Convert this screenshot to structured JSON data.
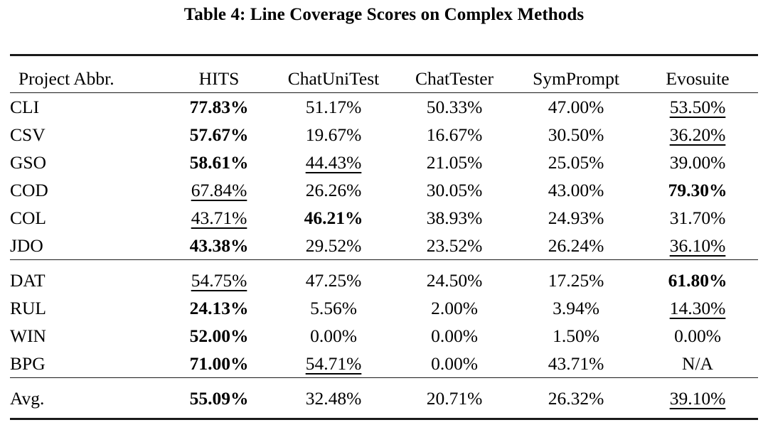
{
  "caption": "Table 4: Line Coverage Scores on Complex Methods",
  "table": {
    "columns": [
      {
        "key": "project",
        "label": "Project Abbr.",
        "align": "left"
      },
      {
        "key": "hits",
        "label": "HITS",
        "align": "center"
      },
      {
        "key": "chatunitest",
        "label": "ChatUniTest",
        "align": "center"
      },
      {
        "key": "chattester",
        "label": "ChatTester",
        "align": "center"
      },
      {
        "key": "symprompt",
        "label": "SymPrompt",
        "align": "center"
      },
      {
        "key": "evosuite",
        "label": "Evosuite",
        "align": "center"
      }
    ],
    "groups": [
      {
        "name": "group-1",
        "rows": [
          {
            "project": "CLI",
            "values": [
              "77.83%",
              "51.17%",
              "50.33%",
              "47.00%",
              "53.50%"
            ],
            "styles": [
              "bold",
              "plain",
              "plain",
              "plain",
              "underline"
            ]
          },
          {
            "project": "CSV",
            "values": [
              "57.67%",
              "19.67%",
              "16.67%",
              "30.50%",
              "36.20%"
            ],
            "styles": [
              "bold",
              "plain",
              "plain",
              "plain",
              "underline"
            ]
          },
          {
            "project": "GSO",
            "values": [
              "58.61%",
              "44.43%",
              "21.05%",
              "25.05%",
              "39.00%"
            ],
            "styles": [
              "bold",
              "underline",
              "plain",
              "plain",
              "plain"
            ]
          },
          {
            "project": "COD",
            "values": [
              "67.84%",
              "26.26%",
              "30.05%",
              "43.00%",
              "79.30%"
            ],
            "styles": [
              "underline",
              "plain",
              "plain",
              "plain",
              "bold"
            ]
          },
          {
            "project": "COL",
            "values": [
              "43.71%",
              "46.21%",
              "38.93%",
              "24.93%",
              "31.70%"
            ],
            "styles": [
              "underline",
              "bold",
              "plain",
              "plain",
              "plain"
            ]
          },
          {
            "project": "JDO",
            "values": [
              "43.38%",
              "29.52%",
              "23.52%",
              "26.24%",
              "36.10%"
            ],
            "styles": [
              "bold",
              "plain",
              "plain",
              "plain",
              "underline"
            ]
          }
        ]
      },
      {
        "name": "group-2",
        "rows": [
          {
            "project": "DAT",
            "values": [
              "54.75%",
              "47.25%",
              "24.50%",
              "17.25%",
              "61.80%"
            ],
            "styles": [
              "underline",
              "plain",
              "plain",
              "plain",
              "bold"
            ]
          },
          {
            "project": "RUL",
            "values": [
              "24.13%",
              "5.56%",
              "2.00%",
              "3.94%",
              "14.30%"
            ],
            "styles": [
              "bold",
              "plain",
              "plain",
              "plain",
              "underline"
            ]
          },
          {
            "project": "WIN",
            "values": [
              "52.00%",
              "0.00%",
              "0.00%",
              "1.50%",
              "0.00%"
            ],
            "styles": [
              "bold",
              "plain",
              "plain",
              "plain",
              "plain"
            ]
          },
          {
            "project": "BPG",
            "values": [
              "71.00%",
              "54.71%",
              "0.00%",
              "43.71%",
              "N/A"
            ],
            "styles": [
              "bold",
              "underline",
              "plain",
              "plain",
              "plain"
            ]
          }
        ]
      },
      {
        "name": "summary",
        "rows": [
          {
            "project": "Avg.",
            "values": [
              "55.09%",
              "32.48%",
              "20.71%",
              "26.32%",
              "39.10%"
            ],
            "styles": [
              "bold",
              "plain",
              "plain",
              "plain",
              "underline"
            ]
          }
        ]
      }
    ]
  }
}
